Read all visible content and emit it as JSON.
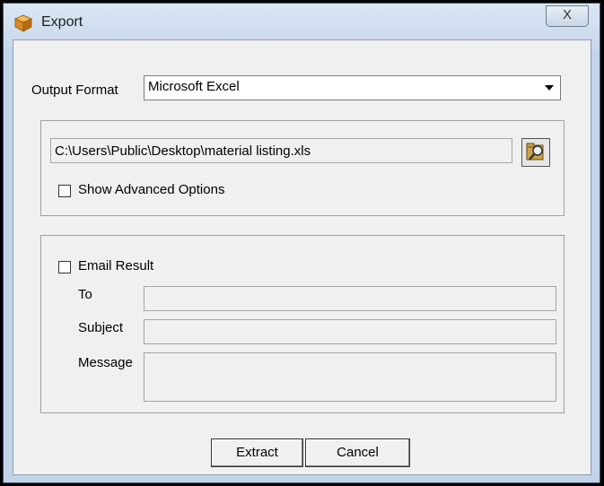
{
  "window": {
    "title": "Export",
    "close_label": "X"
  },
  "output_format": {
    "label": "Output Format",
    "selected": "Microsoft Excel"
  },
  "file": {
    "path": "C:\\Users\\Public\\Desktop\\material listing.xls",
    "show_advanced_label": "Show Advanced Options",
    "show_advanced_checked": false
  },
  "email": {
    "checkbox_label": "Email Result",
    "checked": false,
    "to_label": "To",
    "to_value": "",
    "subject_label": "Subject",
    "subject_value": "",
    "message_label": "Message",
    "message_value": ""
  },
  "buttons": {
    "extract": "Extract",
    "cancel": "Cancel"
  },
  "icons": {
    "app": "package-cube-icon",
    "browse": "folder-search-icon",
    "dropdown": "chevron-down-icon"
  }
}
